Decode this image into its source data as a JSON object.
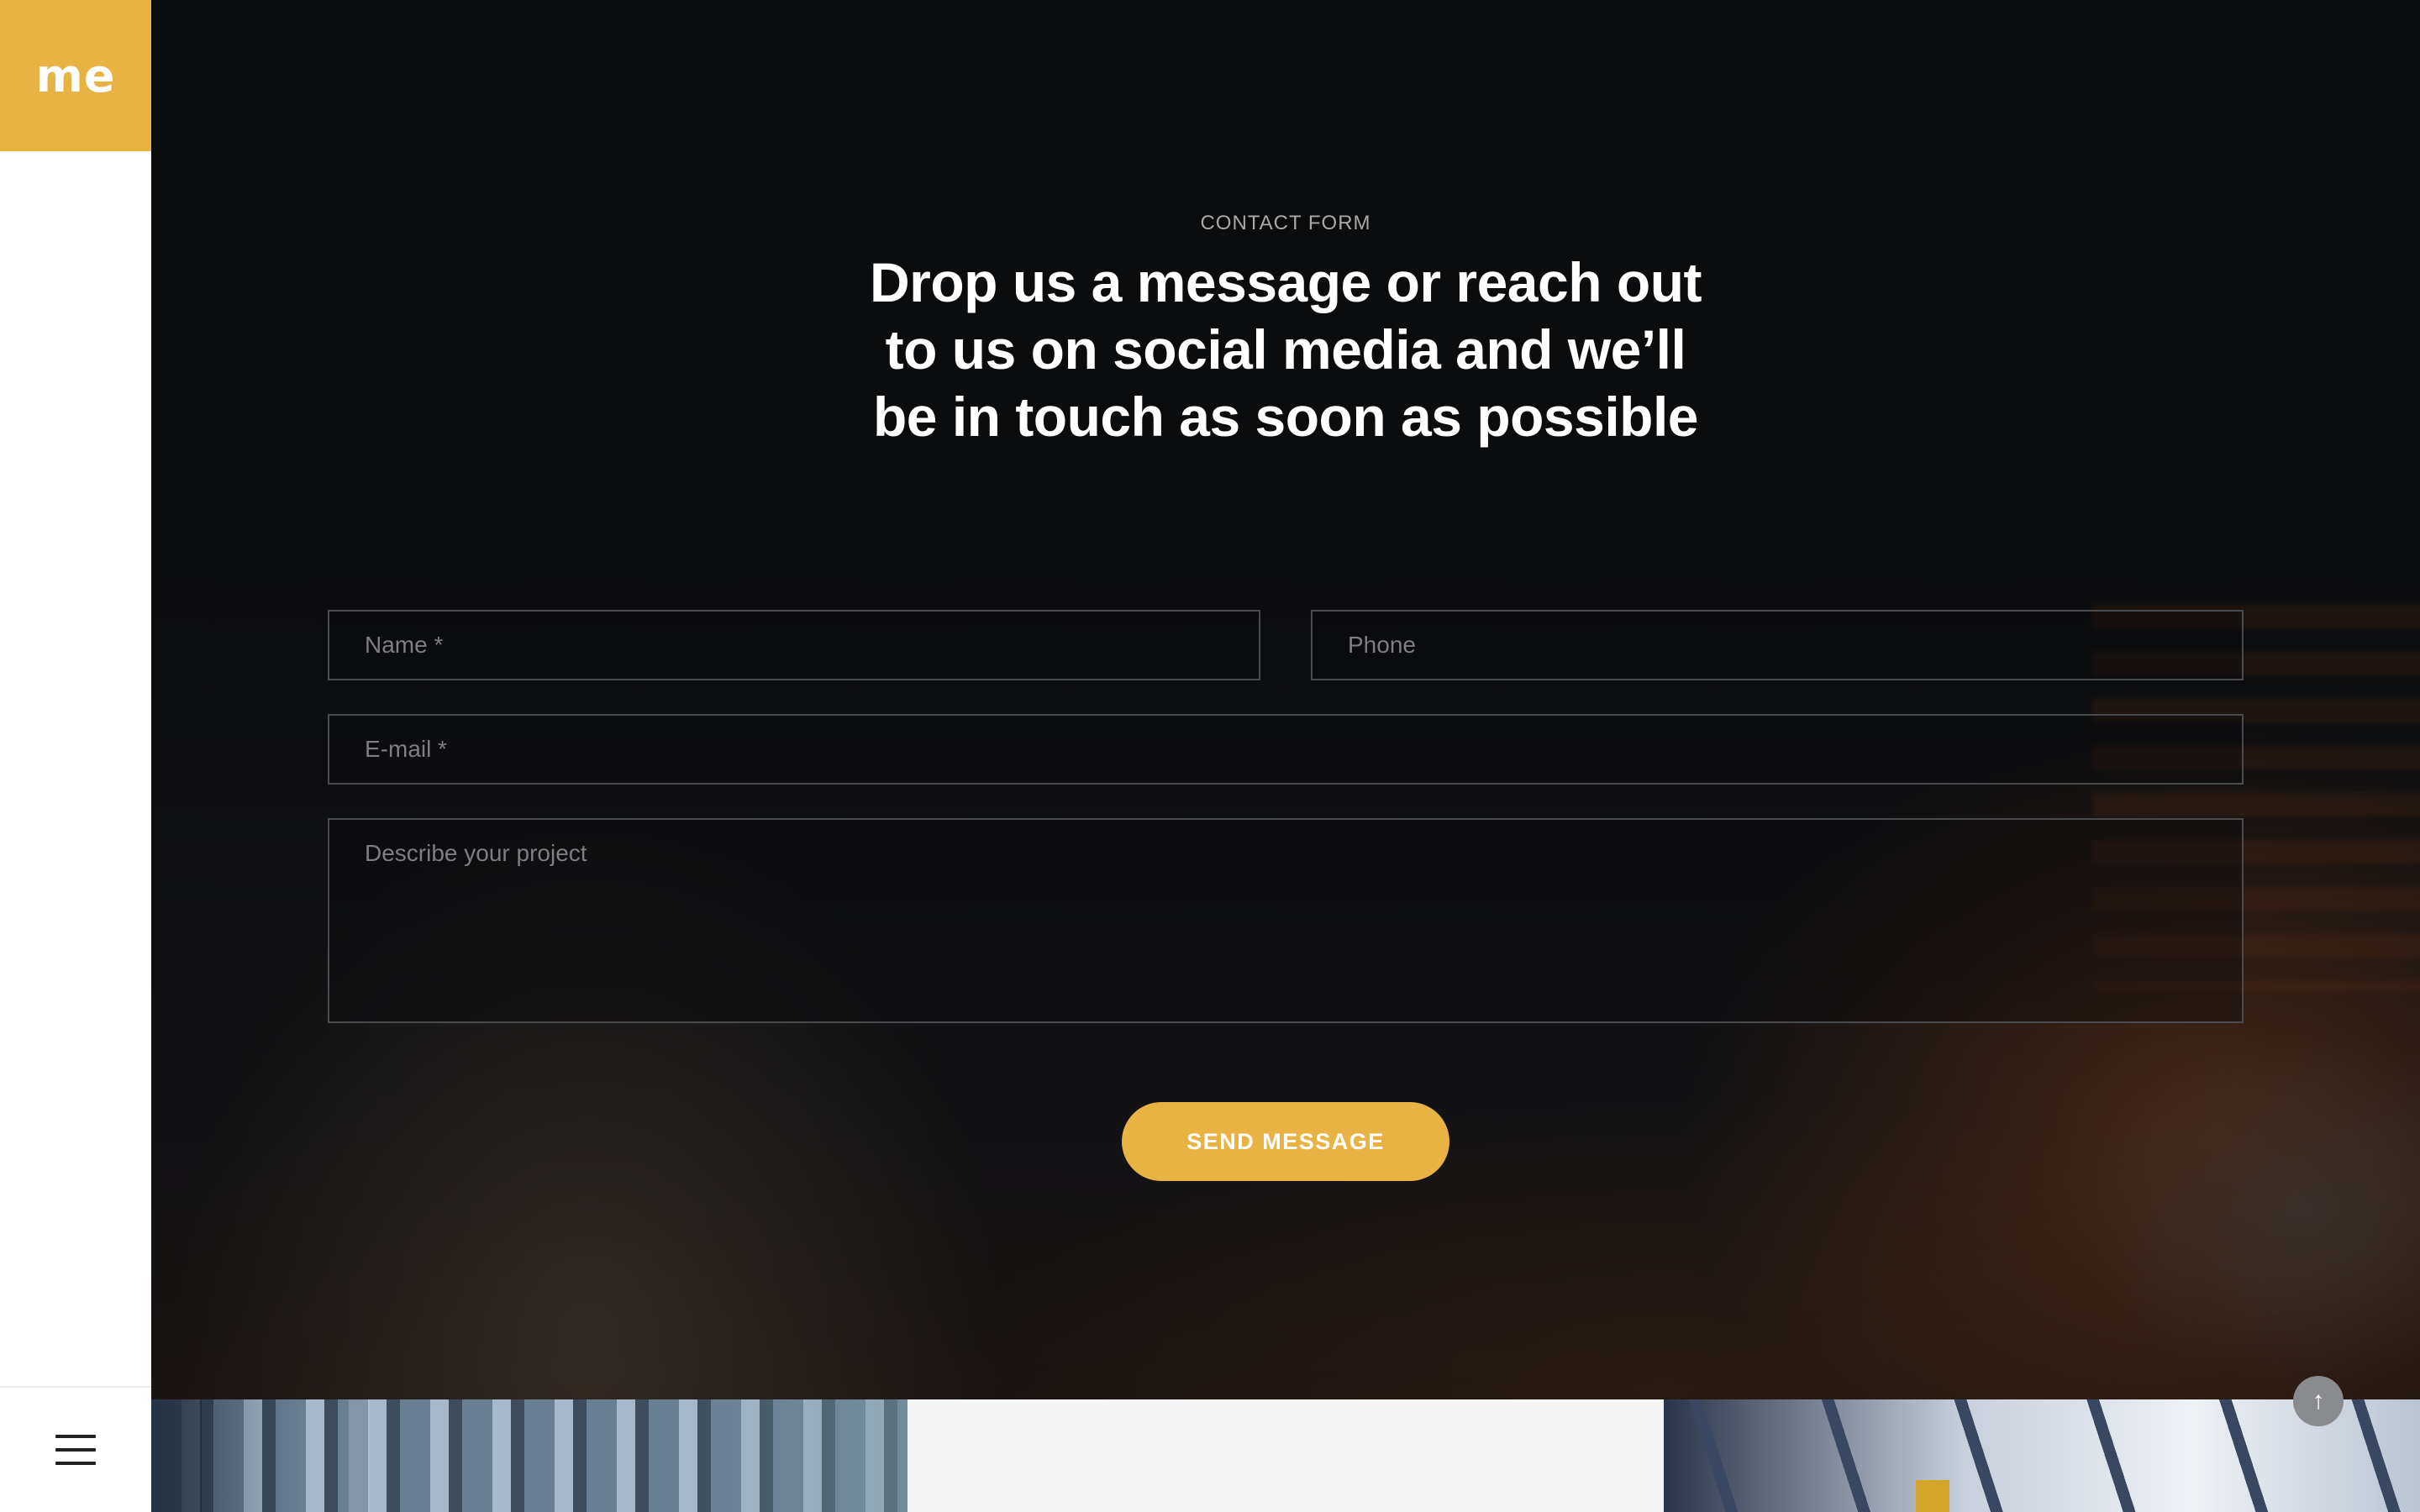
{
  "brand": {
    "logo_text": "me",
    "accent_color": "#e8b342"
  },
  "sidebar": {
    "menu_icon": "hamburger-menu-icon"
  },
  "contact": {
    "eyebrow": "CONTACT FORM",
    "headline": "Drop us a message or reach out to us on social media and we’ll be in touch as soon as possible",
    "fields": {
      "name_placeholder": "Name *",
      "phone_placeholder": "Phone",
      "email_placeholder": "E-mail *",
      "message_placeholder": "Describe your project"
    },
    "submit_label": "SEND MESSAGE"
  },
  "scroll_top": {
    "icon": "arrow-up-icon",
    "glyph": "↑"
  }
}
